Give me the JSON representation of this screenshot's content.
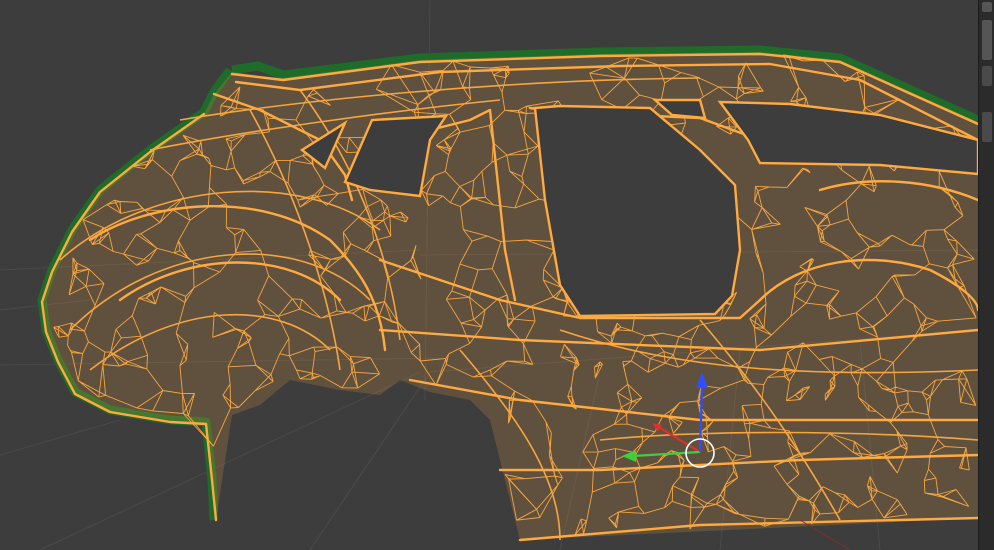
{
  "viewport": {
    "background": "#3d3d3d",
    "grid_color": "#4a4a4a",
    "wire_color": "#ffaa40",
    "outline_color": "#1f6b2a",
    "glass_color": "#3d3d3d",
    "shading": "wireframe",
    "object": "car-body-mesh"
  },
  "gizmo": {
    "x_color": "#d93030",
    "y_color": "#3ecf3e",
    "z_color": "#2f4fff",
    "center_color": "#ffffff"
  },
  "side_panel": {
    "background": "#2b2b2b"
  }
}
